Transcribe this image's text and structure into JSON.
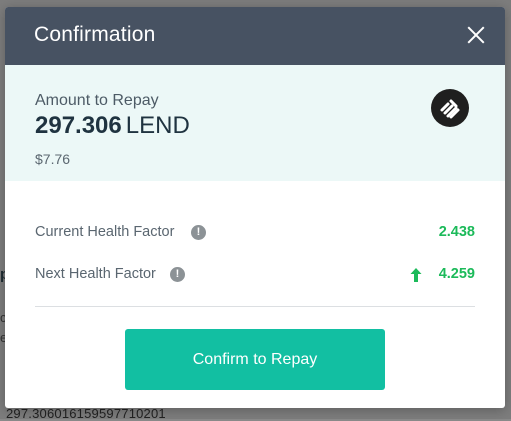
{
  "background": {
    "fragment_p": "p",
    "fragment_c": "c",
    "fragment_e": "e",
    "fragment_number": "297.306016159597710201"
  },
  "modal": {
    "title": "Confirmation",
    "close_icon": "close-icon"
  },
  "amount": {
    "label": "Amount to Repay",
    "value": "297.306",
    "token": "LEND",
    "usd": "$7.76",
    "token_icon": "lend-token-icon"
  },
  "health": {
    "current": {
      "label": "Current Health Factor",
      "info_icon": "info-icon",
      "info_glyph": "!",
      "value": "2.438"
    },
    "next": {
      "label": "Next Health Factor",
      "info_icon": "info-icon",
      "info_glyph": "!",
      "value": "4.259",
      "trend_icon": "arrow-up-icon"
    }
  },
  "actions": {
    "confirm_label": "Confirm to Repay"
  },
  "colors": {
    "header_bg": "#475262",
    "panel_bg": "#ecf8f7",
    "positive": "#1cba5a",
    "button_bg": "#12bfa2"
  }
}
